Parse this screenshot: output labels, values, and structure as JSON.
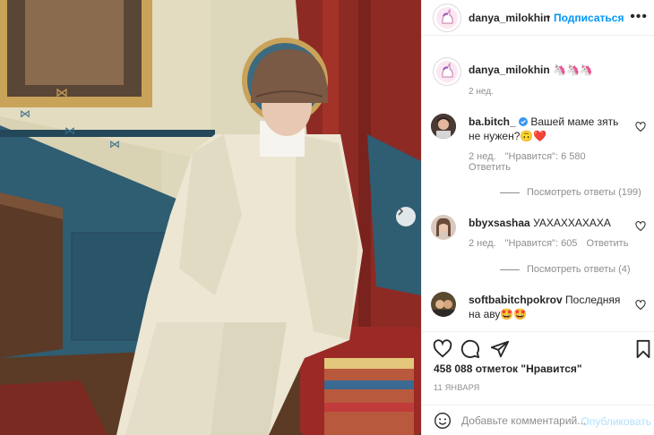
{
  "post": {
    "author": "danya_milokhin",
    "follow_label": "Подписаться",
    "separator": "•",
    "more_label": "•••",
    "caption_emoji": "🦄🦄🦄",
    "caption_time": "2 нед.",
    "likes_text": "458 088 отметок \"Нравится\"",
    "date_text": "11 ЯНВАРЯ"
  },
  "comments": [
    {
      "username": "ba.bitch_",
      "verified": true,
      "text": "Вашей маме зять не нужен?🙃❤️",
      "time": "2 нед.",
      "likes": "\"Нравится\": 6 580",
      "reply": "Ответить",
      "view_replies": "Посмотреть ответы (199)"
    },
    {
      "username": "bbyxsashaa",
      "verified": false,
      "text": "УАХАХХАХАХА",
      "time": "2 нед.",
      "likes": "\"Нравится\": 605",
      "reply": "Ответить",
      "view_replies": "Посмотреть ответы (4)"
    },
    {
      "username": "softbabitchpokrov",
      "verified": false,
      "text": "Последняя на аву🤩🤩"
    }
  ],
  "composer": {
    "placeholder": "Добавьте комментарий...",
    "publish_label": "Опубликовать"
  },
  "colors": {
    "accent": "#0095f6",
    "text": "#262626",
    "muted": "#8e8e8e",
    "publish_disabled": "#b2dffc",
    "heart": "#ed4956"
  },
  "icons": {
    "like": "heart-icon",
    "comment": "comment-bubble-icon",
    "share": "paper-plane-icon",
    "save": "bookmark-icon",
    "emoji": "smiley-icon",
    "next": "chevron-right-icon"
  }
}
